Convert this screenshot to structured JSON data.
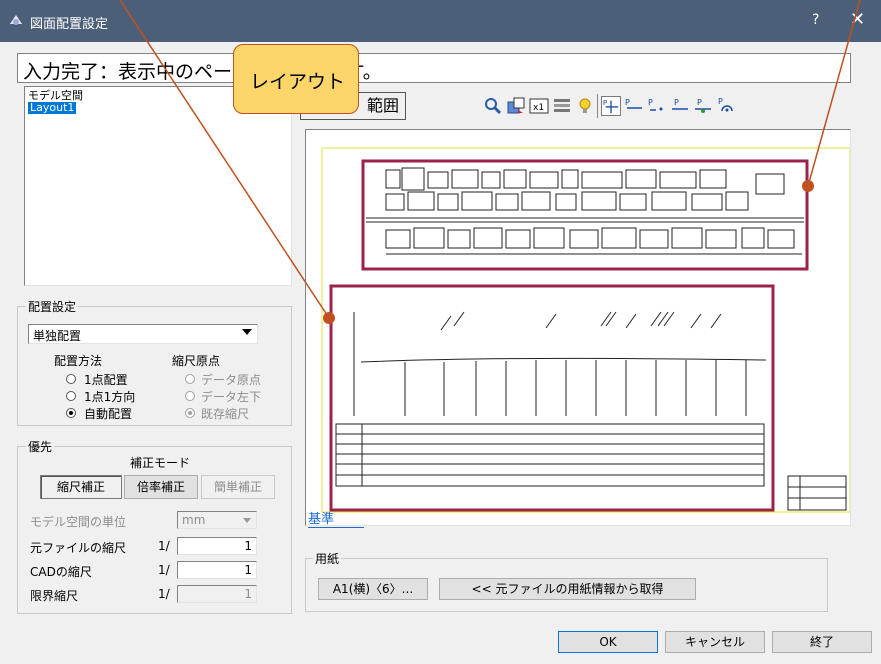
{
  "window": {
    "title": "図面配置設定",
    "help": "?",
    "close": "✕"
  },
  "status_text": "入力完了：表示中のページを配置します。",
  "tooltip": {
    "label": "レイアウト"
  },
  "range_button": "範囲",
  "layout_list": {
    "items": [
      "モデル空間",
      "Layout1"
    ],
    "selected": 1
  },
  "placement": {
    "group_label": "配置設定",
    "mode": "単独配置",
    "method_label": "配置方法",
    "methods": [
      "1点配置",
      "1点1方向",
      "自動配置"
    ],
    "method_selected": 2,
    "origin_label": "縮尺原点",
    "origins": [
      "データ原点",
      "データ左下",
      "既存縮尺"
    ],
    "origin_selected": 2
  },
  "priority": {
    "group_label": "優先",
    "mode_label": "補正モード",
    "buttons": [
      "縮尺補正",
      "倍率補正",
      "簡単補正"
    ],
    "unit_label": "モデル空間の単位",
    "unit_value": "mm",
    "rows": [
      {
        "label": "元ファイルの縮尺",
        "prefix": "1/",
        "value": "1"
      },
      {
        "label": "CADの縮尺",
        "prefix": "1/",
        "value": "1"
      },
      {
        "label": "限界縮尺",
        "prefix": "1/",
        "value": "1"
      }
    ]
  },
  "preview": {
    "kijun": "基準"
  },
  "paper": {
    "group_label": "用紙",
    "size_button": "A1(横)〈6〉...",
    "fetch_button": "<<  元ファイルの用紙情報から取得"
  },
  "footer": {
    "ok": "OK",
    "cancel": "キャンセル",
    "exit": "終了"
  },
  "colors": {
    "titlebar": "#4c5f78",
    "callout": "#fcd66a",
    "frame": "#9b2248",
    "arrow": "#c0501e",
    "selection": "#0078d7"
  }
}
